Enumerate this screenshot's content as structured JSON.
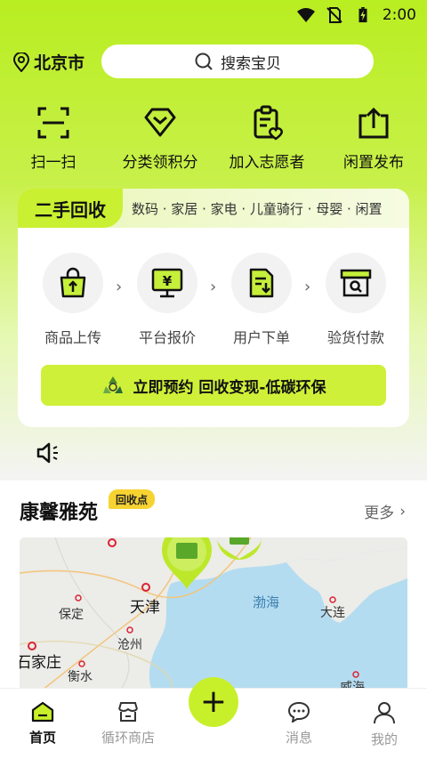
{
  "status_bar": {
    "time": "2:00",
    "icons": [
      "wifi-icon",
      "no-sim-icon",
      "battery-charging-icon"
    ]
  },
  "header": {
    "location": "北京市",
    "location_icon": "location-pin-icon",
    "search_placeholder": "搜索宝贝",
    "search_icon": "search-icon"
  },
  "quick_actions": [
    {
      "label": "扫一扫",
      "icon": "scan-icon"
    },
    {
      "label": "分类领积分",
      "icon": "gem-icon"
    },
    {
      "label": "加入志愿者",
      "icon": "volunteer-clipboard-icon"
    },
    {
      "label": "闲置发布",
      "icon": "upload-box-icon"
    }
  ],
  "recycle_card": {
    "title": "二手回收",
    "categories": "数码 · 家居 · 家电 · 儿童骑行 · 母婴 · 闲置",
    "steps": [
      {
        "label": "商品上传",
        "icon": "bag-upload-icon"
      },
      {
        "label": "平台报价",
        "icon": "price-monitor-icon"
      },
      {
        "label": "用户下单",
        "icon": "order-doc-icon"
      },
      {
        "label": "验货付款",
        "icon": "inspect-box-icon"
      }
    ],
    "cta_label": "立即预约 回收变现-低碳环保",
    "cta_icon": "recycle-icon"
  },
  "announcement_icon": "speaker-icon",
  "location_section": {
    "title": "康馨雅苑",
    "badge": "回收点",
    "more_label": "更多",
    "map_labels": {
      "tianjin": "天津",
      "baoding": "保定",
      "cangzhou": "沧州",
      "shijiazhuang": "石家庄",
      "hengshui": "衡水",
      "bohai": "渤海",
      "dalian": "大连",
      "weihai": "威海"
    }
  },
  "tabbar": {
    "tabs": [
      {
        "label": "首页",
        "icon": "home-icon",
        "active": true
      },
      {
        "label": "循环商店",
        "icon": "store-icon",
        "active": false
      },
      {
        "label": "消息",
        "icon": "message-icon",
        "active": false
      },
      {
        "label": "我的",
        "icon": "user-icon",
        "active": false
      }
    ],
    "fab_icon": "plus-icon"
  },
  "colors": {
    "accent": "#c8f02a",
    "badge": "#f7d332",
    "sea": "#b4dcf0"
  }
}
